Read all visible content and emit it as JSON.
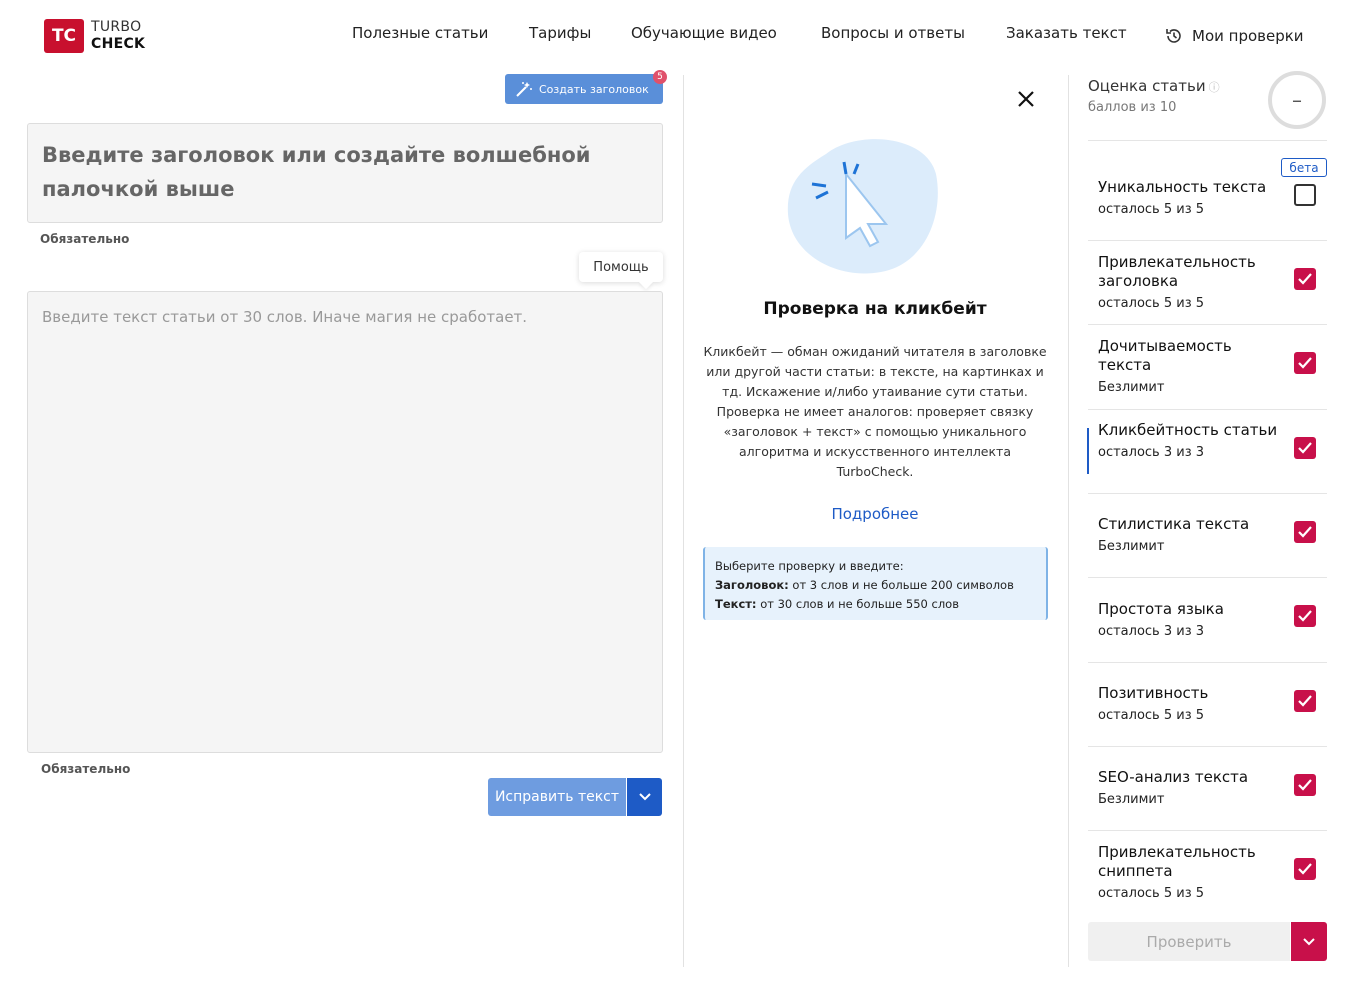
{
  "brand": {
    "logo_mark": "TC",
    "line1": "TURBO",
    "line2": "CHECK",
    "accent": "#c8102e"
  },
  "nav": {
    "articles": "Полезные статьи",
    "tariffs": "Тарифы",
    "videos": "Обучающие видео",
    "faq": "Вопросы и ответы",
    "order": "Заказать текст",
    "my_checks": "Мои проверки"
  },
  "editor": {
    "create_title_button": "Создать заголовок",
    "create_title_badge": "5",
    "title_placeholder": "Введите заголовок или создайте волшебной палочкой выше",
    "title_required": "Обязательно",
    "help_tooltip": "Помощь",
    "text_placeholder": "Введите текст статьи от 30 слов. Иначе магия не сработает.",
    "text_required": "Обязательно",
    "fix_button": "Исправить текст"
  },
  "info_panel": {
    "title": "Проверка на кликбейт",
    "description": "Кликбейт — обман ожиданий читателя в заголовке или другой части статьи: в тексте, на картинках и тд. Искажение и/либо утаивание сути статьи. Проверка не имеет аналогов: проверяет связку «заголовок + текст» с помощью уникального алгоритма и искусственного интеллекта TurboCheck.",
    "more_link": "Подробнее",
    "hint_intro": "Выберите проверку и введите:",
    "hint_title_label": "Заголовок:",
    "hint_title_text": "от 3 слов и не больше 200 символов",
    "hint_text_label": "Текст:",
    "hint_text_text": "от 30 слов и не больше 550 слов"
  },
  "score": {
    "title": "Оценка статьи",
    "subtitle": "баллов из 10",
    "value": "–"
  },
  "beta_label": "бета",
  "checks": [
    {
      "name": "Уникальность текста",
      "sub": "осталось 5 из 5",
      "checked": false
    },
    {
      "name": "Привлекательность заголовка",
      "sub": "осталось 5 из 5",
      "checked": true
    },
    {
      "name": "Дочитываемость текста",
      "sub": "Безлимит",
      "checked": true
    },
    {
      "name": "Кликбейтность статьи",
      "sub": "осталось 3 из 3",
      "checked": true
    },
    {
      "name": "Стилистика текста",
      "sub": "Безлимит",
      "checked": true
    },
    {
      "name": "Простота языка",
      "sub": "осталось 3 из 3",
      "checked": true
    },
    {
      "name": "Позитивность",
      "sub": "осталось 5 из 5",
      "checked": true
    },
    {
      "name": "SEO-анализ текста",
      "sub": "Безлимит",
      "checked": true
    },
    {
      "name": "Привлекательность сниппета",
      "sub": "осталось 5 из 5",
      "checked": true
    }
  ],
  "verify_button": "Проверить",
  "colors": {
    "checkbox_on": "#c8104a",
    "primary_blue": "#1e5bc6",
    "button_blue": "#6e9ce0"
  },
  "icons": [
    "history-icon",
    "magic-wand-icon",
    "close-icon",
    "cursor-click-icon",
    "chevron-down-icon",
    "check-icon"
  ]
}
